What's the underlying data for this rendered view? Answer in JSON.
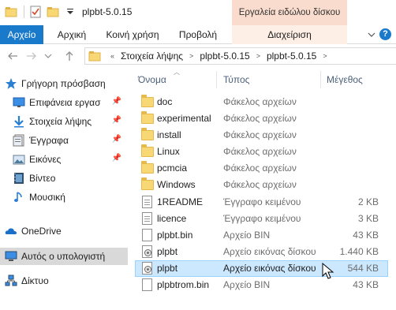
{
  "window": {
    "title": "plpbt-5.0.15",
    "context_tab_header": "Εργαλεία ειδώλου δίσκου"
  },
  "ribbon": {
    "tabs": [
      {
        "label": "Αρχείο"
      },
      {
        "label": "Αρχική"
      },
      {
        "label": "Κοινή χρήση"
      },
      {
        "label": "Προβολή"
      },
      {
        "label": "Διαχείριση"
      }
    ]
  },
  "address": {
    "crumbs": [
      "Στοιχεία λήψης",
      "plpbt-5.0.15",
      "plpbt-5.0.15"
    ]
  },
  "nav": {
    "items": [
      {
        "label": "Γρήγορη πρόσβαση",
        "icon": "star-icon"
      },
      {
        "label": "Επιφάνεια εργασ",
        "icon": "desktop-icon",
        "pinned": true
      },
      {
        "label": "Στοιχεία λήψης",
        "icon": "download-icon",
        "pinned": true
      },
      {
        "label": "Έγγραφα",
        "icon": "documents-icon",
        "pinned": true
      },
      {
        "label": "Εικόνες",
        "icon": "pictures-icon",
        "pinned": true
      },
      {
        "label": "Βίντεο",
        "icon": "video-icon"
      },
      {
        "label": "Μουσική",
        "icon": "music-icon"
      },
      {
        "label": "OneDrive",
        "icon": "cloud-icon"
      },
      {
        "label": "Αυτός ο υπολογιστή",
        "icon": "computer-icon"
      },
      {
        "label": "Δίκτυο",
        "icon": "network-icon"
      }
    ]
  },
  "columns": {
    "name": "Όνομα",
    "type": "Τύπος",
    "size": "Μέγεθος"
  },
  "files": [
    {
      "name": "doc",
      "type": "Φάκελος αρχείων",
      "size": "",
      "icon": "folder-icon"
    },
    {
      "name": "experimental",
      "type": "Φάκελος αρχείων",
      "size": "",
      "icon": "folder-icon"
    },
    {
      "name": "install",
      "type": "Φάκελος αρχείων",
      "size": "",
      "icon": "folder-icon"
    },
    {
      "name": "Linux",
      "type": "Φάκελος αρχείων",
      "size": "",
      "icon": "folder-icon"
    },
    {
      "name": "pcmcia",
      "type": "Φάκελος αρχείων",
      "size": "",
      "icon": "folder-icon"
    },
    {
      "name": "Windows",
      "type": "Φάκελος αρχείων",
      "size": "",
      "icon": "folder-icon"
    },
    {
      "name": "1README",
      "type": "Έγγραφο κειμένου",
      "size": "2 KB",
      "icon": "text-document-icon"
    },
    {
      "name": "licence",
      "type": "Έγγραφο κειμένου",
      "size": "3 KB",
      "icon": "text-document-icon"
    },
    {
      "name": "plpbt.bin",
      "type": "Αρχείο BIN",
      "size": "43 KB",
      "icon": "file-icon"
    },
    {
      "name": "plpbt",
      "type": "Αρχείο εικόνας δίσκου",
      "size": "1.440 KB",
      "icon": "disc-image-icon"
    },
    {
      "name": "plpbt",
      "type": "Αρχείο εικόνας δίσκου",
      "size": "544 KB",
      "icon": "disc-image-icon",
      "selected": true
    },
    {
      "name": "plpbtrom.bin",
      "type": "Αρχείο BIN",
      "size": "43 KB",
      "icon": "file-icon"
    }
  ],
  "colors": {
    "file_tab": "#1979ca",
    "context_tab": "#f9dccd",
    "selection": "#cce8ff",
    "folder": "#f8d775"
  }
}
